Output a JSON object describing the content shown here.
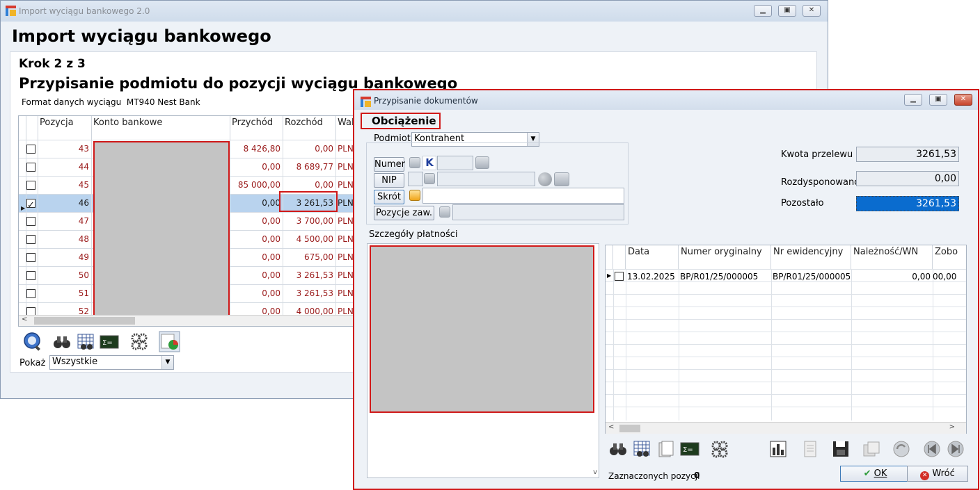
{
  "bg_window": {
    "title": "Import wyciągu bankowego 2.0",
    "heading": "Import wyciągu bankowego",
    "step": "Krok 2 z 3",
    "subtitle": "Przypisanie podmiotu do pozycji wyciągu bankowego",
    "format_label": "Format danych wyciągu",
    "format_value": "MT940 Nest Bank",
    "columns": [
      "Pozycja",
      "Konto bankowe",
      "Przychód",
      "Rozchód",
      "Wal"
    ],
    "rows": [
      {
        "pos": "43",
        "income": "8 426,80",
        "expense": "0,00",
        "cur": "PLN",
        "checked": false,
        "selected": false
      },
      {
        "pos": "44",
        "income": "0,00",
        "expense": "8 689,77",
        "cur": "PLN",
        "checked": false,
        "selected": false
      },
      {
        "pos": "45",
        "income": "85 000,00",
        "expense": "0,00",
        "cur": "PLN",
        "checked": false,
        "selected": false
      },
      {
        "pos": "46",
        "income": "0,00",
        "expense": "3 261,53",
        "cur": "PLN",
        "checked": true,
        "selected": true
      },
      {
        "pos": "47",
        "income": "0,00",
        "expense": "3 700,00",
        "cur": "PLN",
        "checked": false,
        "selected": false
      },
      {
        "pos": "48",
        "income": "0,00",
        "expense": "4 500,00",
        "cur": "PLN",
        "checked": false,
        "selected": false
      },
      {
        "pos": "49",
        "income": "0,00",
        "expense": "675,00",
        "cur": "PLN",
        "checked": false,
        "selected": false
      },
      {
        "pos": "50",
        "income": "0,00",
        "expense": "3 261,53",
        "cur": "PLN",
        "checked": false,
        "selected": false
      },
      {
        "pos": "51",
        "income": "0,00",
        "expense": "3 261,53",
        "cur": "PLN",
        "checked": false,
        "selected": false
      },
      {
        "pos": "52",
        "income": "0,00",
        "expense": "4 000,00",
        "cur": "PLN",
        "checked": false,
        "selected": false
      }
    ],
    "show_label": "Pokaż",
    "show_value": "Wszystkie"
  },
  "dialog": {
    "title": "Przypisanie dokumentów",
    "type": "Obciążenie",
    "subject_label": "Podmiot",
    "subject_value": "Kontrahent",
    "buttons": {
      "numer": "Numer",
      "nip": "NIP",
      "skrot": "Skrót",
      "pozycje": "Pozycje zaw."
    },
    "k_letter": "K",
    "kwota_label": "Kwota przelewu",
    "kwota_value": "3261,53",
    "rozd_label": "Rozdysponowano",
    "rozd_value": "0,00",
    "poz_label": "Pozostało",
    "poz_value": "3261,53",
    "details_label": "Szczegóły płatności",
    "columns": [
      "Data",
      "Numer oryginalny",
      "Nr ewidencyjny",
      "Należność/WN",
      "Zobo"
    ],
    "docs": [
      {
        "date": "13.02.2025",
        "orig": "BP/R01/25/000005",
        "ewid": "BP/R01/25/000005",
        "wn": "0,00",
        "zobo": "00,00"
      }
    ],
    "selected_label": "Zaznaczonych pozycji",
    "selected_count": "0",
    "ok_label": "OK",
    "back_label": "Wróć"
  }
}
